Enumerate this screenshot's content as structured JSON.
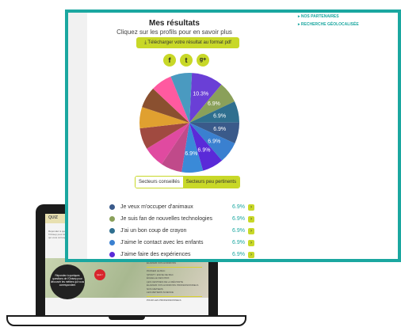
{
  "laptop": {
    "quiz_label": "QUIZ",
    "text": "Répondez à quelques questions de l'Onisep pour découvrir les métiers qui vous correspondent",
    "circle_text": "Répondez à quelques questions de l'Onisep pour découvrir les métiers qui vous correspondent",
    "red_badge": "Quiz !",
    "sidebar": [
      "ÉLARGIR VOS HORIZONS",
      "PASSER LE BAC",
      "SPORT / ENVIE DE BAC",
      "ÉCHELLE DES PRIX",
      "LES CENTRES DE LA RÉUSSITE",
      "ÉLARGIR VOS HORIZONS PROFESSIONNELS",
      "NOS METIERS",
      "LES METIERS SCIENCE",
      "POUR LES PROFESSIONNELS"
    ]
  },
  "menu": {
    "items": [
      "NOS PARTENAIRES",
      "RECHERCHE GÉOLOCALISÉE"
    ]
  },
  "results": {
    "title": "Mes résultats",
    "subtitle": "Cliquez sur les profils pour en savoir plus",
    "download_label": "Télécharger votre résultat au format pdf"
  },
  "social": {
    "facebook": "f",
    "twitter": "t",
    "google": "g+"
  },
  "chart_data": {
    "type": "pie",
    "values": [
      10.3,
      6.9,
      6.9,
      6.9,
      6.9,
      6.9,
      6.9,
      6.9,
      6.9,
      6.9,
      6.9,
      6.9,
      6.9,
      6.9
    ],
    "labels": [
      "10.3%",
      "6.9%",
      "6.9%",
      "6.9%",
      "6.9%",
      "6.9%",
      "6.9%",
      "",
      "",
      "",
      "",
      "",
      "",
      ""
    ],
    "colors": [
      "#6a3fd6",
      "#8aa05a",
      "#2f6f8f",
      "#3a5a8a",
      "#3a80d0",
      "#5a2ad8",
      "#3a8ad8",
      "#c04a8a",
      "#e04aa0",
      "#a04a40",
      "#e0a030",
      "#8a5030",
      "#ff5aa0",
      "#4a9ac0"
    ]
  },
  "toggle": {
    "on_label": "Secteurs conseillés",
    "off_label": "Secteurs peu pertinents"
  },
  "legend": [
    {
      "label": "Je veux m'occuper d'animaux",
      "value": "6.9%",
      "color": "#3a5a8a"
    },
    {
      "label": "Je suis fan de nouvelles technologies",
      "value": "6.9%",
      "color": "#8aa05a"
    },
    {
      "label": "J'ai un bon coup de crayon",
      "value": "6.9%",
      "color": "#2f6f8f"
    },
    {
      "label": "J'aime le contact avec les enfants",
      "value": "6.9%",
      "color": "#3a80d0"
    },
    {
      "label": "J'aime faire des expériences",
      "value": "6.9%",
      "color": "#5a2ad8"
    }
  ]
}
